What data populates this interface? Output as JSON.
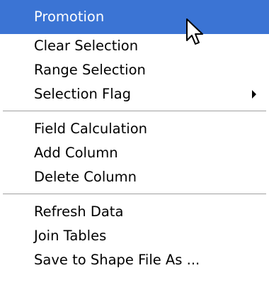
{
  "menu": {
    "groups": [
      {
        "items": [
          {
            "label": "Promotion",
            "highlighted": true,
            "submenu": false
          },
          {
            "label": "Clear Selection",
            "highlighted": false,
            "submenu": false
          },
          {
            "label": "Range Selection",
            "highlighted": false,
            "submenu": false
          },
          {
            "label": "Selection Flag",
            "highlighted": false,
            "submenu": true
          }
        ]
      },
      {
        "items": [
          {
            "label": "Field Calculation",
            "highlighted": false,
            "submenu": false
          },
          {
            "label": "Add Column",
            "highlighted": false,
            "submenu": false
          },
          {
            "label": "Delete Column",
            "highlighted": false,
            "submenu": false
          }
        ]
      },
      {
        "items": [
          {
            "label": "Refresh Data",
            "highlighted": false,
            "submenu": false
          },
          {
            "label": "Join Tables",
            "highlighted": false,
            "submenu": false
          },
          {
            "label": "Save to Shape File As ...",
            "highlighted": false,
            "submenu": false
          }
        ]
      }
    ]
  },
  "cursor": {
    "icon": "arrow-pointer-icon"
  },
  "colors": {
    "highlight_bg": "#3b74d4",
    "highlight_text": "#ffffff",
    "text": "#000000",
    "separator": "#a0a0a0"
  }
}
